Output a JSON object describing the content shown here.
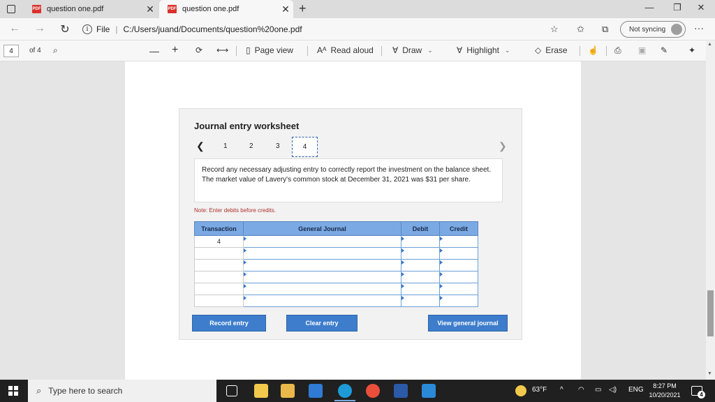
{
  "browser": {
    "tabs": [
      {
        "badge": "PDF",
        "title": "question one.pdf",
        "active": false
      },
      {
        "badge": "PDF",
        "title": "question one.pdf",
        "active": true
      }
    ],
    "address": {
      "prefix": "File",
      "url": "C:/Users/juand/Documents/question%20one.pdf"
    },
    "sync_label": "Not syncing"
  },
  "pdf_toolbar": {
    "page_current": "4",
    "page_total": "of 4",
    "page_view": "Page view",
    "read_aloud": "Read aloud",
    "draw": "Draw",
    "highlight": "Highlight",
    "erase": "Erase"
  },
  "worksheet": {
    "title": "Journal entry worksheet",
    "steps": [
      "1",
      "2",
      "3",
      "4"
    ],
    "current_step": "4",
    "instruction": "Record any necessary adjusting entry to correctly report the investment on the balance sheet. The market value of Lavery's common stock at December 31, 2021 was $31 per share.",
    "note": "Note: Enter debits before credits.",
    "table": {
      "headers": [
        "Transaction",
        "General Journal",
        "Debit",
        "Credit"
      ],
      "rows": [
        {
          "transaction": "4",
          "account": "",
          "debit": "",
          "credit": ""
        },
        {
          "transaction": "",
          "account": "",
          "debit": "",
          "credit": ""
        },
        {
          "transaction": "",
          "account": "",
          "debit": "",
          "credit": ""
        },
        {
          "transaction": "",
          "account": "",
          "debit": "",
          "credit": ""
        },
        {
          "transaction": "",
          "account": "",
          "debit": "",
          "credit": ""
        },
        {
          "transaction": "",
          "account": "",
          "debit": "",
          "credit": ""
        }
      ]
    },
    "buttons": {
      "record": "Record entry",
      "clear": "Clear entry",
      "view": "View general journal"
    }
  },
  "taskbar": {
    "search_placeholder": "Type here to search",
    "weather": "63°F",
    "language": "ENG",
    "time": "8:27 PM",
    "date": "10/20/2021",
    "notification_count": "4"
  },
  "colors": {
    "header_blue": "#7aa9e3",
    "button_blue": "#3d7dcc",
    "note_red": "#b0302a",
    "pdf_red": "#d9312b"
  }
}
